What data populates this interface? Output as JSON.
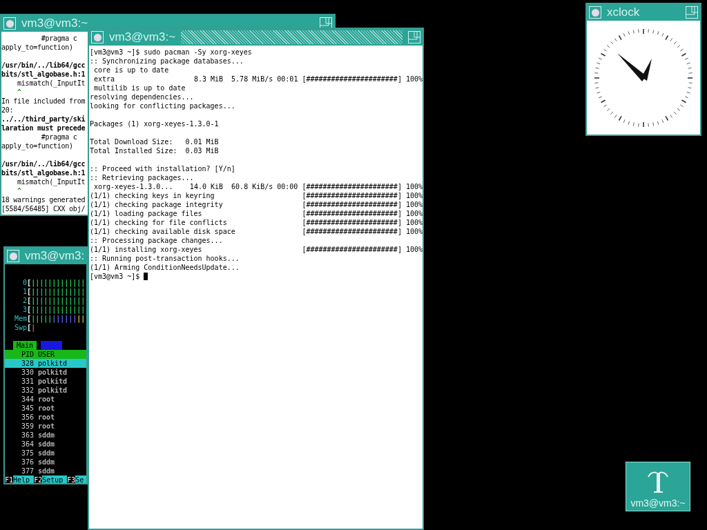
{
  "windows": [
    {
      "kind": "terminal",
      "title": "vm3@vm3:~",
      "active": false,
      "lines": [
        {
          "kind": "text",
          "text": "          #pragma c"
        },
        {
          "kind": "text",
          "text": "apply_to=function)"
        },
        {
          "kind": "blank"
        },
        {
          "kind": "bold",
          "text": "/usr/bin/../lib64/gcc"
        },
        {
          "kind": "bold",
          "text": "bits/stl_algobase.h:1"
        },
        {
          "kind": "text",
          "text": "    mismatch(_InputIt"
        },
        {
          "kind": "caret",
          "text": "    ^"
        },
        {
          "kind": "text",
          "text": "In file included from"
        },
        {
          "kind": "text",
          "text": "20:"
        },
        {
          "kind": "bold",
          "text": "../../third_party/ski"
        },
        {
          "kind": "bold",
          "text": "laration must precede"
        },
        {
          "kind": "text",
          "text": "          #pragma c"
        },
        {
          "kind": "text",
          "text": "apply_to=function)"
        },
        {
          "kind": "blank"
        },
        {
          "kind": "bold",
          "text": "/usr/bin/../lib64/gcc"
        },
        {
          "kind": "bold",
          "text": "bits/stl_algobase.h:1"
        },
        {
          "kind": "text",
          "text": "    mismatch(_InputIt"
        },
        {
          "kind": "caret",
          "text": "    ^"
        },
        {
          "kind": "text",
          "text": "18 warnings generated"
        },
        {
          "kind": "text",
          "text": "[5584/56485] CXX obj/"
        }
      ]
    },
    {
      "kind": "htop",
      "title": "vm3@vm3:",
      "active": false,
      "meters": [
        {
          "label": "0",
          "bracket": "[",
          "segments": [
            {
              "kind": "normal",
              "text": "|||||||||||||"
            }
          ]
        },
        {
          "label": "1",
          "bracket": "[",
          "segments": [
            {
              "kind": "normal",
              "text": "|||||||||||||"
            }
          ]
        },
        {
          "label": "2",
          "bracket": "[",
          "segments": [
            {
              "kind": "normal",
              "text": "|||||||||||||"
            }
          ]
        },
        {
          "label": "3",
          "bracket": "[",
          "segments": [
            {
              "kind": "normal",
              "text": "|||||||||||||"
            }
          ]
        },
        {
          "label": "Mem",
          "bracket": "[",
          "segments": [
            {
              "kind": "used",
              "text": "|||||"
            },
            {
              "kind": "buffers",
              "text": "||||||"
            },
            {
              "kind": "cache",
              "text": "||"
            }
          ]
        },
        {
          "label": "Swp",
          "bracket": "[",
          "segments": [
            {
              "kind": "swap",
              "text": "|"
            }
          ]
        }
      ],
      "tabs": [
        {
          "label": "Main",
          "selected": true
        },
        {
          "selected": false
        }
      ],
      "columns": [
        "PID",
        "USER"
      ],
      "processes": [
        {
          "pid": "328",
          "user": "polkitd",
          "selected": true
        },
        {
          "pid": "330",
          "user": "polkitd",
          "selected": false
        },
        {
          "pid": "331",
          "user": "polkitd",
          "selected": false
        },
        {
          "pid": "332",
          "user": "polkitd",
          "selected": false
        },
        {
          "pid": "344",
          "user": "root",
          "selected": false
        },
        {
          "pid": "345",
          "user": "root",
          "selected": false
        },
        {
          "pid": "356",
          "user": "root",
          "selected": false
        },
        {
          "pid": "359",
          "user": "root",
          "selected": false
        },
        {
          "pid": "363",
          "user": "sddm",
          "selected": false
        },
        {
          "pid": "364",
          "user": "sddm",
          "selected": false
        },
        {
          "pid": "375",
          "user": "sddm",
          "selected": false
        },
        {
          "pid": "376",
          "user": "sddm",
          "selected": false
        },
        {
          "pid": "377",
          "user": "sddm",
          "selected": false
        }
      ],
      "function_keys": [
        {
          "key": "F1",
          "label": "Help"
        },
        {
          "key": "F2",
          "label": "Setup"
        },
        {
          "key": "F3",
          "label": "Se"
        }
      ]
    },
    {
      "kind": "terminal",
      "title": "vm3@vm3:~",
      "active": true,
      "cursor": true,
      "lines": [
        {
          "kind": "text",
          "text": "[vm3@vm3 ~]$ sudo pacman -Sy xorg-xeyes"
        },
        {
          "kind": "text",
          "text": ":: Synchronizing package databases..."
        },
        {
          "kind": "text",
          "text": " core is up to date"
        },
        {
          "kind": "progress",
          "text": " extra",
          "info": "8.3 MiB  5.78 MiB/s 00:01",
          "bar": "[######################]",
          "percent": "100%"
        },
        {
          "kind": "text",
          "text": " multilib is up to date"
        },
        {
          "kind": "text",
          "text": "resolving dependencies..."
        },
        {
          "kind": "text",
          "text": "looking for conflicting packages..."
        },
        {
          "kind": "blank"
        },
        {
          "kind": "text",
          "text": "Packages (1) xorg-xeyes-1.3.0-1"
        },
        {
          "kind": "blank"
        },
        {
          "kind": "text",
          "text": "Total Download Size:   0.01 MiB"
        },
        {
          "kind": "text",
          "text": "Total Installed Size:  0.03 MiB"
        },
        {
          "kind": "blank"
        },
        {
          "kind": "text",
          "text": ":: Proceed with installation? [Y/n]"
        },
        {
          "kind": "text",
          "text": ":: Retrieving packages..."
        },
        {
          "kind": "progress",
          "text": " xorg-xeyes-1.3.0...",
          "info": "14.0 KiB  60.8 KiB/s 00:00",
          "bar": "[######################]",
          "percent": "100%"
        },
        {
          "kind": "progress",
          "text": "(1/1) checking keys in keyring",
          "bar": "[######################]",
          "percent": "100%"
        },
        {
          "kind": "progress",
          "text": "(1/1) checking package integrity",
          "bar": "[######################]",
          "percent": "100%"
        },
        {
          "kind": "progress",
          "text": "(1/1) loading package files",
          "bar": "[######################]",
          "percent": "100%"
        },
        {
          "kind": "progress",
          "text": "(1/1) checking for file conflicts",
          "bar": "[######################]",
          "percent": "100%"
        },
        {
          "kind": "progress",
          "text": "(1/1) checking available disk space",
          "bar": "[######################]",
          "percent": "100%"
        },
        {
          "kind": "text",
          "text": ":: Processing package changes..."
        },
        {
          "kind": "progress",
          "text": "(1/1) installing xorg-xeyes",
          "bar": "[######################]",
          "percent": "100%"
        },
        {
          "kind": "text",
          "text": ":: Running post-transaction hooks..."
        },
        {
          "kind": "text",
          "text": "(1/1) Arming ConditionNeedsUpdate..."
        },
        {
          "kind": "text",
          "text": "[vm3@vm3 ~]$ "
        }
      ]
    },
    {
      "kind": "clock",
      "title": "xclock",
      "active": false
    }
  ],
  "icons": [
    {
      "label": "vm3@vm3:~"
    }
  ]
}
